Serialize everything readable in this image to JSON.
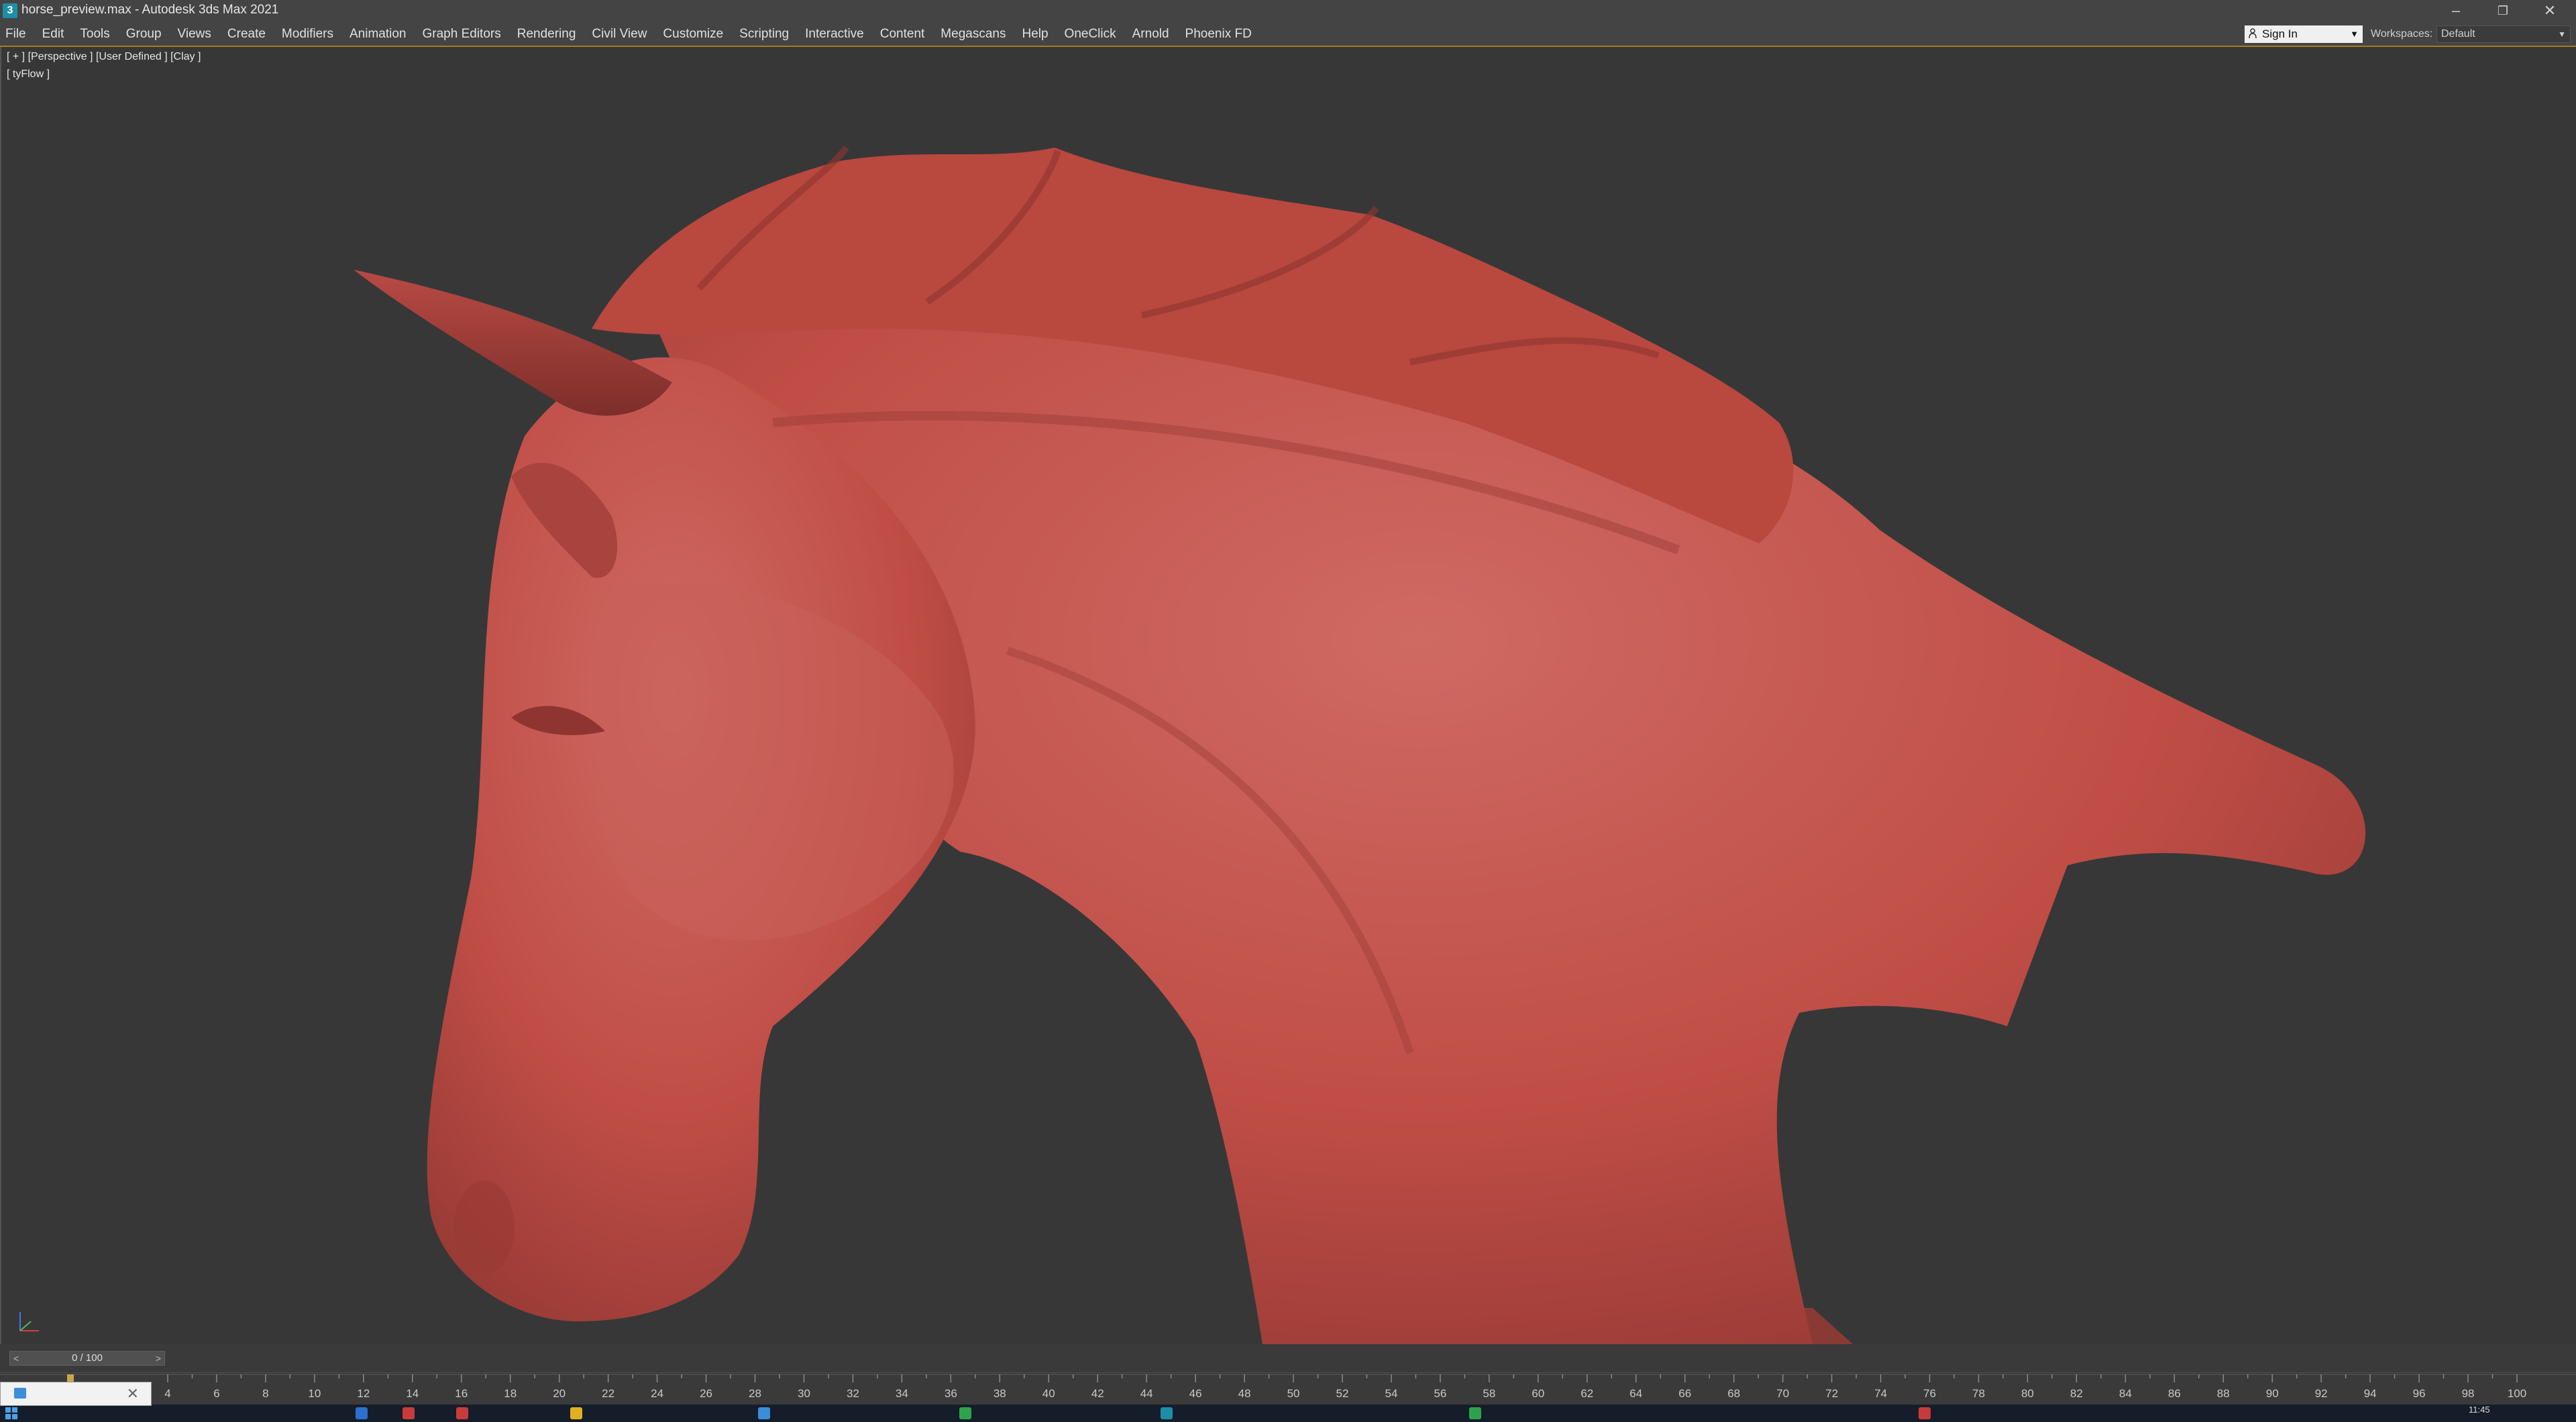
{
  "window": {
    "title": "horse_preview.max - Autodesk 3ds Max 2021",
    "app_icon_glyph": "3",
    "buttons": {
      "minimize": "–",
      "restore": "❐",
      "close": "✕"
    }
  },
  "menubar": {
    "items": [
      "File",
      "Edit",
      "Tools",
      "Group",
      "Views",
      "Create",
      "Modifiers",
      "Animation",
      "Graph Editors",
      "Rendering",
      "Civil View",
      "Customize",
      "Scripting",
      "Interactive",
      "Content",
      "Megascans",
      "Help",
      "OneClick",
      "Arnold",
      "Phoenix FD"
    ],
    "sign_in": "Sign In",
    "workspaces_label": "Workspaces:",
    "workspaces_value": "Default"
  },
  "viewport": {
    "label": "[ + ] [Perspective ] [User Defined ] [Clay ]",
    "tyflow_label": "[ tyFlow ]",
    "model_color": "#c4504a",
    "background_color": "#373737"
  },
  "timeslider": {
    "frame_display": "0 / 100",
    "prev_glyph": "<",
    "next_glyph": ">"
  },
  "trackbar": {
    "tick_labels": [
      "4",
      "6",
      "8",
      "10",
      "12",
      "14",
      "16",
      "18",
      "20",
      "22",
      "24",
      "26",
      "28",
      "30",
      "32",
      "34",
      "36",
      "38",
      "40",
      "42",
      "44",
      "46",
      "48",
      "50",
      "52",
      "54",
      "56",
      "58",
      "60",
      "62",
      "64",
      "66",
      "68",
      "70",
      "72",
      "74",
      "76",
      "78",
      "80",
      "82",
      "84",
      "86",
      "88",
      "90",
      "92",
      "94",
      "96",
      "98",
      "100"
    ]
  },
  "taskbar": {
    "time": "11:45",
    "close_glyph": "✕"
  }
}
